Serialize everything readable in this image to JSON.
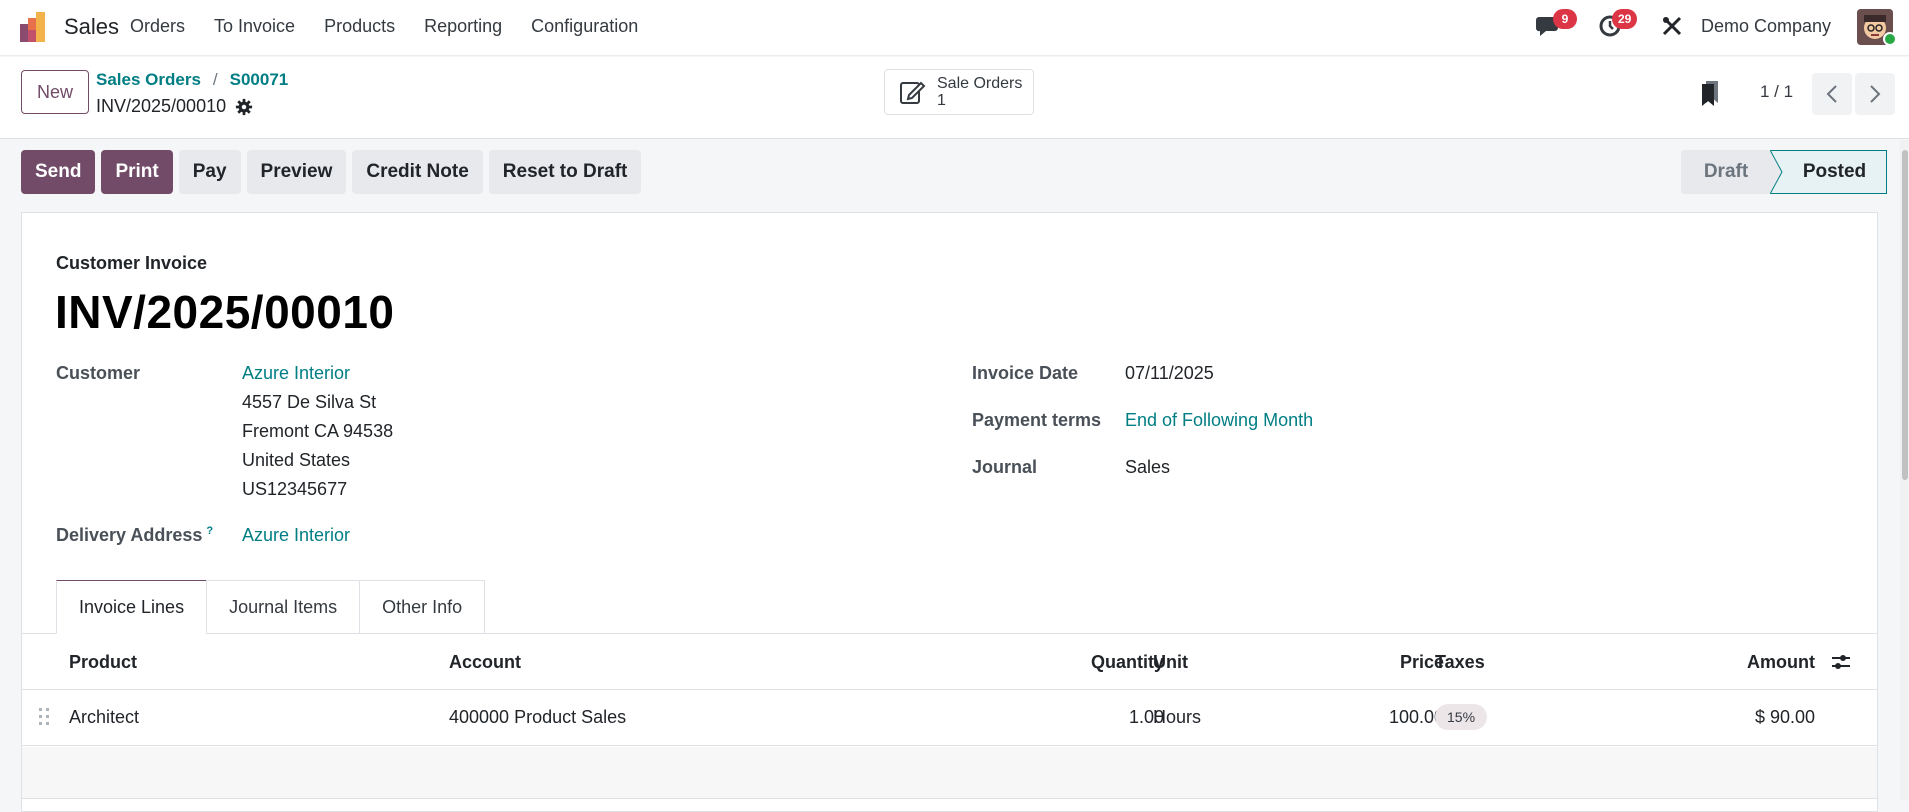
{
  "navbar": {
    "app_name": "Sales",
    "menu": [
      "Orders",
      "To Invoice",
      "Products",
      "Reporting",
      "Configuration"
    ],
    "messages_count": "9",
    "activities_count": "29",
    "company": "Demo Company"
  },
  "control": {
    "new_label": "New",
    "breadcrumb": [
      "Sales Orders",
      "S00071"
    ],
    "record_name": "INV/2025/00010",
    "smart_button": {
      "label": "Sale Orders",
      "count": "1"
    },
    "pager": "1 / 1"
  },
  "actions": [
    "Send",
    "Print",
    "Pay",
    "Preview",
    "Credit Note",
    "Reset to Draft"
  ],
  "status": {
    "draft": "Draft",
    "posted": "Posted",
    "current": "Posted"
  },
  "invoice": {
    "type": "Customer Invoice",
    "name": "INV/2025/00010",
    "customer_label": "Customer",
    "customer": "Azure Interior",
    "address": [
      "4557 De Silva St",
      "Fremont CA 94538",
      "United States",
      "US12345677"
    ],
    "delivery_label": "Delivery Address",
    "delivery_help": "?",
    "delivery": "Azure Interior",
    "date_label": "Invoice Date",
    "date": "07/11/2025",
    "terms_label": "Payment terms",
    "terms": "End of Following Month",
    "journal_label": "Journal",
    "journal": "Sales"
  },
  "tabs": [
    "Invoice Lines",
    "Journal Items",
    "Other Info"
  ],
  "table": {
    "headers": {
      "product": "Product",
      "account": "Account",
      "quantity": "Quantity",
      "unit": "Unit",
      "price": "Price",
      "taxes": "Taxes",
      "amount": "Amount"
    },
    "rows": [
      {
        "product": "Architect",
        "account": "400000 Product Sales",
        "quantity": "1.00",
        "unit": "Hours",
        "price": "100.00",
        "taxes": "15%",
        "amount": "$ 90.00"
      }
    ]
  },
  "colors": {
    "primary": "#714b67",
    "link": "#017e84",
    "badge": "#dc3545"
  }
}
